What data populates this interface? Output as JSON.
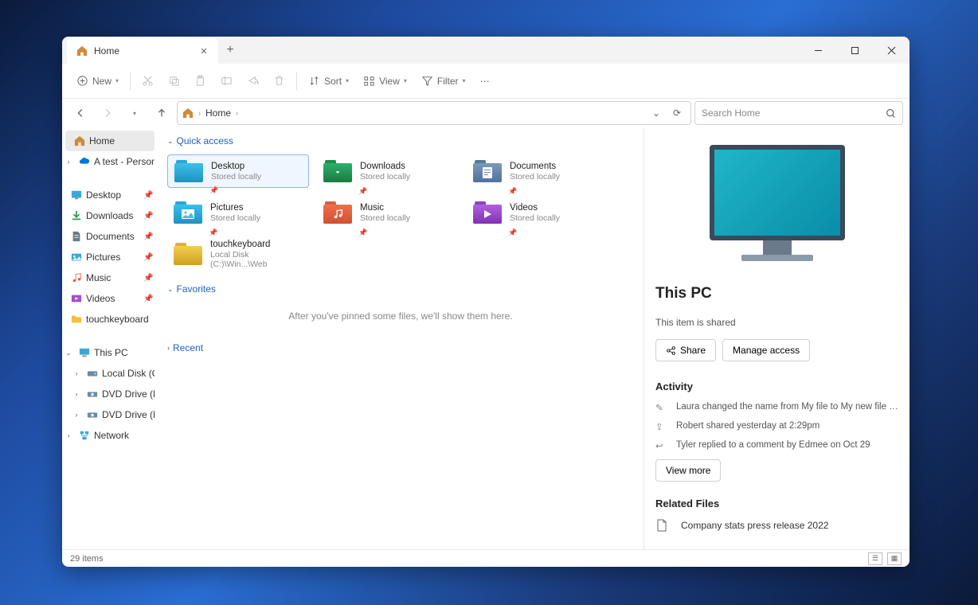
{
  "tab": {
    "title": "Home"
  },
  "toolbar": {
    "new": "New",
    "sort": "Sort",
    "view": "View",
    "filter": "Filter"
  },
  "address": {
    "crumb": "Home"
  },
  "search": {
    "placeholder": "Search Home"
  },
  "sidebar": {
    "home": "Home",
    "atest": "A test - Personal",
    "desktop": "Desktop",
    "downloads": "Downloads",
    "documents": "Documents",
    "pictures": "Pictures",
    "music": "Music",
    "videos": "Videos",
    "touchkeyboard": "touchkeyboard",
    "thispc": "This PC",
    "localdisk": "Local Disk (C:)",
    "dvd_d": "DVD Drive (D:) CC",
    "dvd_d2": "DVD Drive (D:) CCC",
    "network": "Network"
  },
  "sections": {
    "quick": "Quick access",
    "favorites": "Favorites",
    "recent": "Recent"
  },
  "qa": [
    {
      "name": "Desktop",
      "sub": "Stored locally"
    },
    {
      "name": "Downloads",
      "sub": "Stored locally"
    },
    {
      "name": "Documents",
      "sub": "Stored locally"
    },
    {
      "name": "Pictures",
      "sub": "Stored locally"
    },
    {
      "name": "Music",
      "sub": "Stored locally"
    },
    {
      "name": "Videos",
      "sub": "Stored locally"
    },
    {
      "name": "touchkeyboard",
      "sub": "Local Disk (C:)\\Win...\\Web"
    }
  ],
  "favorites_empty": "After you've pinned some files, we'll show them here.",
  "details": {
    "title": "This PC",
    "shared": "This item is shared",
    "share_btn": "Share",
    "manage_btn": "Manage access",
    "activity_hdr": "Activity",
    "activity": [
      "Laura changed the name from My file to My new file with a long nan",
      "Robert shared yesterday at 2:29pm",
      "Tyler replied to a comment by Edmee on Oct 29"
    ],
    "viewmore": "View more",
    "related_hdr": "Related Files",
    "related": "Company stats press release 2022"
  },
  "status": {
    "items": "29 items"
  }
}
